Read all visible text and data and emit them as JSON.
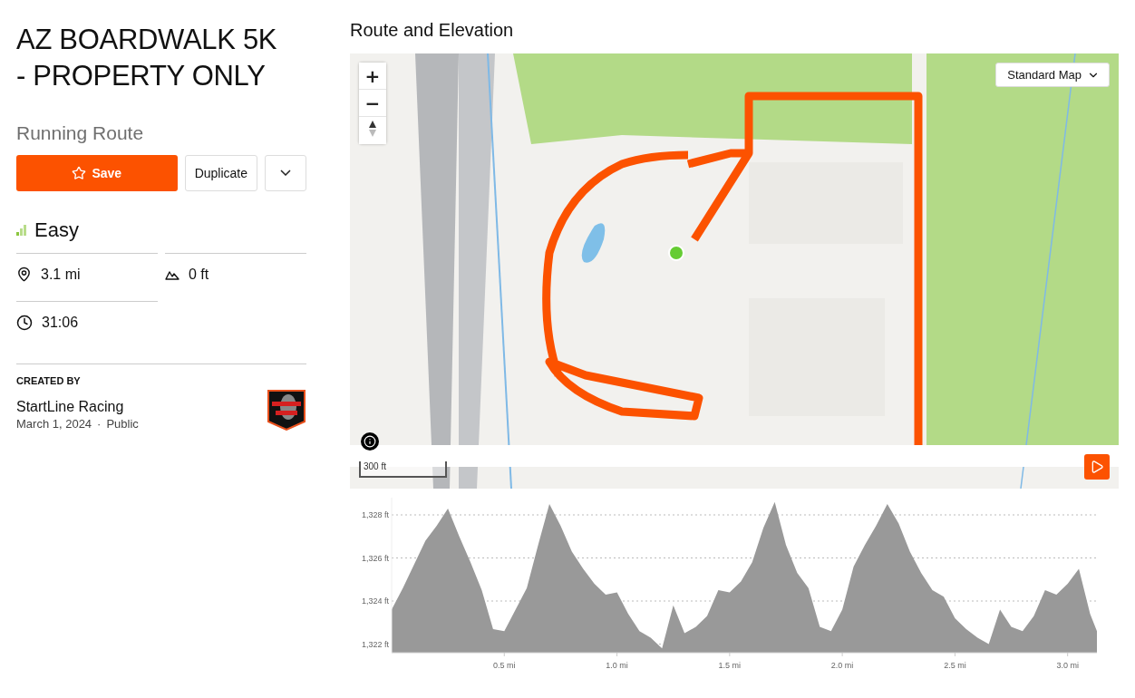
{
  "route": {
    "title": "AZ BOARDWALK 5K - PROPERTY ONLY",
    "activity": "Running Route"
  },
  "actions": {
    "save": "Save",
    "duplicate": "Duplicate"
  },
  "difficulty": "Easy",
  "stats": [
    {
      "kind": "distance",
      "value": "3.1 mi"
    },
    {
      "kind": "elevation",
      "value": "0 ft"
    },
    {
      "kind": "time",
      "value": "31:06"
    }
  ],
  "creator": {
    "heading": "CREATED BY",
    "name": "StartLine Racing",
    "date": "March 1, 2024",
    "separator": "·",
    "visibility": "Public"
  },
  "section_title": "Route and Elevation",
  "map": {
    "zoom_in": "+",
    "zoom_out": "−",
    "map_type": "Standard Map",
    "scale": "300 ft"
  },
  "elevation": {
    "chart_data": {
      "type": "area",
      "x": [
        0,
        0.05,
        0.1,
        0.15,
        0.2,
        0.25,
        0.3,
        0.35,
        0.4,
        0.45,
        0.5,
        0.55,
        0.6,
        0.65,
        0.7,
        0.75,
        0.8,
        0.85,
        0.9,
        0.95,
        1.0,
        1.05,
        1.1,
        1.15,
        1.2,
        1.25,
        1.3,
        1.35,
        1.4,
        1.45,
        1.5,
        1.55,
        1.6,
        1.65,
        1.7,
        1.75,
        1.8,
        1.85,
        1.9,
        1.95,
        2.0,
        2.05,
        2.1,
        2.15,
        2.2,
        2.25,
        2.3,
        2.35,
        2.4,
        2.45,
        2.5,
        2.55,
        2.6,
        2.65,
        2.7,
        2.75,
        2.8,
        2.85,
        2.9,
        2.95,
        3.0,
        3.05,
        3.1,
        3.13
      ],
      "series": [
        {
          "color": "#999999",
          "values": [
            1323.6,
            1324.6,
            1325.7,
            1326.8,
            1327.5,
            1328.3,
            1327.0,
            1325.8,
            1324.5,
            1322.7,
            1322.6,
            1323.6,
            1324.6,
            1326.6,
            1328.5,
            1327.5,
            1326.3,
            1325.5,
            1324.8,
            1324.3,
            1324.4,
            1323.4,
            1322.6,
            1322.3,
            1321.8,
            1323.8,
            1322.5,
            1322.8,
            1323.3,
            1324.5,
            1324.4,
            1324.9,
            1325.8,
            1327.4,
            1328.6,
            1326.6,
            1325.3,
            1324.6,
            1322.8,
            1322.6,
            1323.6,
            1325.6,
            1326.6,
            1327.5,
            1328.5,
            1327.6,
            1326.3,
            1325.3,
            1324.5,
            1324.2,
            1323.2,
            1322.7,
            1322.3,
            1322.0,
            1323.6,
            1322.8,
            1322.6,
            1323.3,
            1324.5,
            1324.3,
            1324.8,
            1325.5,
            1323.4,
            1322.6
          ]
        }
      ],
      "xlim": [
        0,
        3.13
      ],
      "ylim": [
        1321.6,
        1328.8
      ],
      "grid": true,
      "xticks": [
        {
          "value": 0.5,
          "label": "0.5 mi"
        },
        {
          "value": 1.0,
          "label": "1.0 mi"
        },
        {
          "value": 1.5,
          "label": "1.5 mi"
        },
        {
          "value": 2.0,
          "label": "2.0 mi"
        },
        {
          "value": 2.5,
          "label": "2.5 mi"
        },
        {
          "value": 3.0,
          "label": "3.0 mi"
        }
      ],
      "yticks": [
        {
          "value": 1322,
          "label": "1,322 ft"
        },
        {
          "value": 1324,
          "label": "1,324 ft"
        },
        {
          "value": 1326,
          "label": "1,326 ft"
        },
        {
          "value": 1328,
          "label": "1,328 ft"
        }
      ]
    }
  }
}
